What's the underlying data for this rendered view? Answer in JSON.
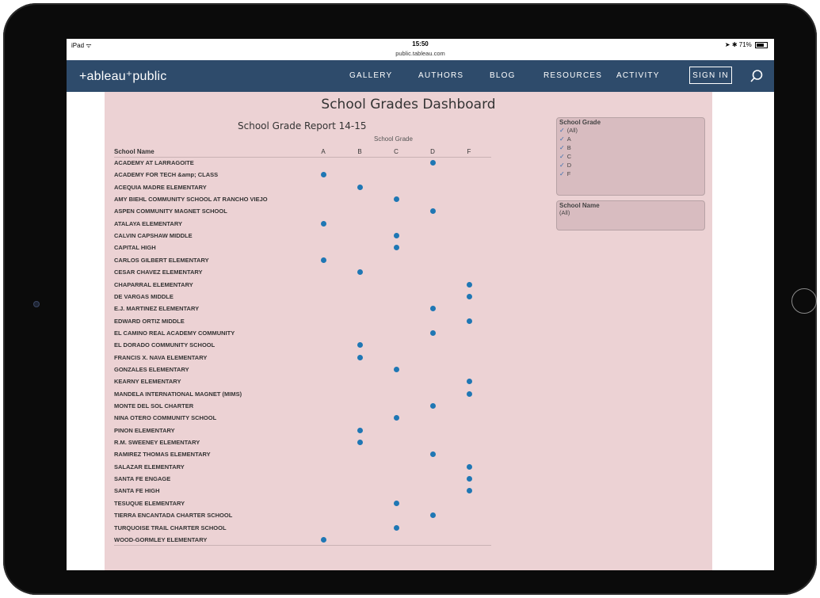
{
  "status": {
    "device": "iPad",
    "time": "15:50",
    "url": "public.tableau.com",
    "battery": "71%"
  },
  "nav": {
    "logo": "+ableau⁺public",
    "items": [
      "GALLERY",
      "AUTHORS",
      "BLOG",
      "RESOURCES",
      "ACTIVITY"
    ],
    "sign_in": "SIGN IN"
  },
  "dashboard": {
    "title": "School Grades Dashboard",
    "report_title": "School Grade Report 14-15"
  },
  "chart_data": {
    "type": "table",
    "axis_title": "School Grade",
    "row_header": "School Name",
    "columns": [
      "A",
      "B",
      "C",
      "D",
      "F"
    ],
    "rows": [
      {
        "name": "ACADEMY AT LARRAGOITE",
        "grade": "D"
      },
      {
        "name": "ACADEMY FOR TECH &amp; CLASS",
        "grade": "A"
      },
      {
        "name": "ACEQUIA MADRE ELEMENTARY",
        "grade": "B"
      },
      {
        "name": "AMY BIEHL COMMUNITY SCHOOL AT RANCHO VIEJO",
        "grade": "C"
      },
      {
        "name": "ASPEN COMMUNITY MAGNET SCHOOL",
        "grade": "D"
      },
      {
        "name": "ATALAYA ELEMENTARY",
        "grade": "A"
      },
      {
        "name": "CALVIN CAPSHAW MIDDLE",
        "grade": "C"
      },
      {
        "name": "CAPITAL HIGH",
        "grade": "C"
      },
      {
        "name": "CARLOS GILBERT ELEMENTARY",
        "grade": "A"
      },
      {
        "name": "CESAR CHAVEZ ELEMENTARY",
        "grade": "B"
      },
      {
        "name": "CHAPARRAL ELEMENTARY",
        "grade": "F"
      },
      {
        "name": "DE VARGAS MIDDLE",
        "grade": "F"
      },
      {
        "name": "E.J. MARTINEZ ELEMENTARY",
        "grade": "D"
      },
      {
        "name": "EDWARD ORTIZ MIDDLE",
        "grade": "F"
      },
      {
        "name": "EL CAMINO REAL ACADEMY COMMUNITY",
        "grade": "D"
      },
      {
        "name": "EL DORADO COMMUNITY SCHOOL",
        "grade": "B"
      },
      {
        "name": "FRANCIS X. NAVA ELEMENTARY",
        "grade": "B"
      },
      {
        "name": "GONZALES ELEMENTARY",
        "grade": "C"
      },
      {
        "name": "KEARNY ELEMENTARY",
        "grade": "F"
      },
      {
        "name": "MANDELA INTERNATIONAL MAGNET (MIMS)",
        "grade": "F"
      },
      {
        "name": "MONTE DEL SOL CHARTER",
        "grade": "D"
      },
      {
        "name": "NINA OTERO COMMUNITY SCHOOL",
        "grade": "C"
      },
      {
        "name": "PINON ELEMENTARY",
        "grade": "B"
      },
      {
        "name": "R.M. SWEENEY ELEMENTARY",
        "grade": "B"
      },
      {
        "name": "RAMIREZ THOMAS ELEMENTARY",
        "grade": "D"
      },
      {
        "name": "SALAZAR ELEMENTARY",
        "grade": "F"
      },
      {
        "name": "SANTA FE ENGAGE",
        "grade": "F"
      },
      {
        "name": "SANTA FE HIGH",
        "grade": "F"
      },
      {
        "name": "TESUQUE ELEMENTARY",
        "grade": "C"
      },
      {
        "name": "TIERRA ENCANTADA CHARTER SCHOOL",
        "grade": "D"
      },
      {
        "name": "TURQUOISE TRAIL CHARTER SCHOOL",
        "grade": "C"
      },
      {
        "name": "WOOD-GORMLEY ELEMENTARY",
        "grade": "A"
      }
    ],
    "mark_color": "#1f77b4"
  },
  "filters": {
    "grade": {
      "title": "School Grade",
      "options": [
        "(All)",
        "A",
        "B",
        "C",
        "D",
        "F"
      ]
    },
    "school": {
      "title": "School Name",
      "value": "(All)"
    }
  },
  "colors": {
    "navbar": "#2e4b6b",
    "dashboard_bg": "#ecd2d4",
    "check": "#3a6fb0"
  }
}
